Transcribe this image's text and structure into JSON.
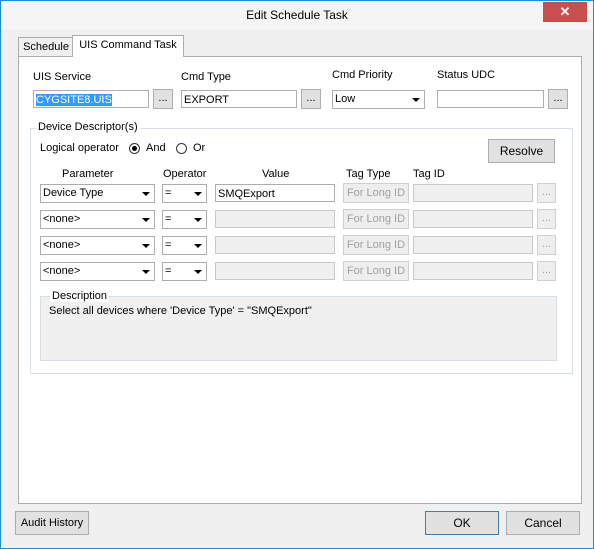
{
  "window": {
    "title": "Edit Schedule Task",
    "close_glyph": "✕"
  },
  "tabs": [
    {
      "label": "Schedule"
    },
    {
      "label": "UIS Command Task"
    }
  ],
  "uis_service": {
    "label": "UIS Service",
    "value": "CYGSITE8.UIS",
    "browse": "..."
  },
  "cmd_type": {
    "label": "Cmd Type",
    "value": "EXPORT",
    "browse": "..."
  },
  "cmd_priority": {
    "label": "Cmd Priority",
    "value": "Low"
  },
  "status_udc": {
    "label": "Status UDC",
    "value": "",
    "browse": "..."
  },
  "device_descriptor": {
    "legend": "Device Descriptor(s)",
    "logical_operator_label": "Logical operator",
    "and_label": "And",
    "or_label": "Or",
    "resolve": "Resolve",
    "headers": {
      "parameter": "Parameter",
      "operator": "Operator",
      "value": "Value",
      "tag_type": "Tag Type",
      "tag_id": "Tag ID"
    },
    "rows": [
      {
        "parameter": "Device Type",
        "operator": "=",
        "value": "SMQExport",
        "tag_type": "For Long ID",
        "browse": "..."
      },
      {
        "parameter": "<none>",
        "operator": "=",
        "value": "",
        "tag_type": "For Long ID",
        "browse": "..."
      },
      {
        "parameter": "<none>",
        "operator": "=",
        "value": "",
        "tag_type": "For Long ID",
        "browse": "..."
      },
      {
        "parameter": "<none>",
        "operator": "=",
        "value": "",
        "tag_type": "For Long ID",
        "browse": "..."
      }
    ],
    "description_legend": "Description",
    "description_text": "Select all devices where 'Device Type' = \"SMQExport\""
  },
  "footer": {
    "audit_history": "Audit History",
    "ok": "OK",
    "cancel": "Cancel"
  }
}
